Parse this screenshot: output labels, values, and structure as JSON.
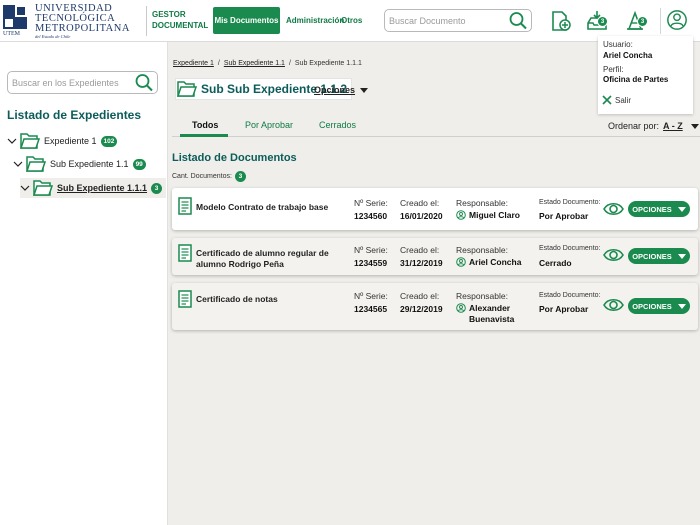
{
  "header": {
    "logo_line1": "UNIVERSIDAD",
    "logo_line2": "TECNOLÓGICA",
    "logo_line3": "METROPOLITANA",
    "logo_sub": "del Estado de Chile",
    "logo_abbr": "UTEM",
    "app_name_line1": "GESTOR",
    "app_name_line2": "DOCUMENTAL",
    "nav": [
      "Mis Documentos",
      "Administración",
      "Otros"
    ],
    "search_placeholder": "Buscar Documento",
    "icons": [
      {
        "name": "new-document-icon",
        "badge": ""
      },
      {
        "name": "inbox-icon",
        "badge": "3"
      },
      {
        "name": "notifications-icon",
        "badge": "3"
      },
      {
        "name": "user-icon",
        "badge": ""
      }
    ],
    "accent": "#1b8a4f",
    "title_color": "#0b5c5a"
  },
  "user_panel": {
    "user_label": "Usuario:",
    "user_name": "Ariel Concha",
    "profile_label": "Perfil:",
    "profile_value": "Oficina de Partes",
    "logout": "Salir"
  },
  "sidebar": {
    "search_placeholder": "Buscar en los Expedientes",
    "title": "Listado de Expedientes",
    "tree": [
      {
        "label": "Expediente 1",
        "badge": "102",
        "level": 0
      },
      {
        "label": "Sub Expediente 1.1",
        "badge": "99",
        "level": 1
      },
      {
        "label": "Sub Expediente 1.1.1",
        "badge": "3",
        "level": 2,
        "selected": true
      }
    ]
  },
  "main": {
    "breadcrumb": [
      "Expediente 1",
      "Sub Expediente 1.1",
      "Sub Expediente 1.1.1"
    ],
    "title": "Sub Sub Expediente 1.1.2",
    "options_label": "Opciones",
    "tabs": [
      "Todos",
      "Por Aprobar",
      "Cerrados"
    ],
    "order_label": "Ordenar por:",
    "order_value": "A - Z",
    "list_title": "Listado de Documentos",
    "count_label": "Cant. Documentos:",
    "count_value": "3",
    "columns": {
      "serie": "Nº Serie:",
      "created": "Creado el:",
      "responsible": "Responsable:",
      "state": "Estado Documento:"
    },
    "action_label": "OPCIONES",
    "documents": [
      {
        "name": "Modelo Contrato de trabajo base",
        "serie": "1234560",
        "created": "16/01/2020",
        "responsible": "Miguel Claro",
        "state": "Por Aprobar"
      },
      {
        "name": "Certificado de alumno regular de alumno Rodrigo Peña",
        "serie": "1234559",
        "created": "31/12/2019",
        "responsible": "Ariel Concha",
        "state": "Cerrado"
      },
      {
        "name": "Certificado de notas",
        "serie": "1234565",
        "created": "29/12/2019",
        "responsible": "Alexander Buenavista",
        "state": "Por Aprobar"
      }
    ]
  }
}
